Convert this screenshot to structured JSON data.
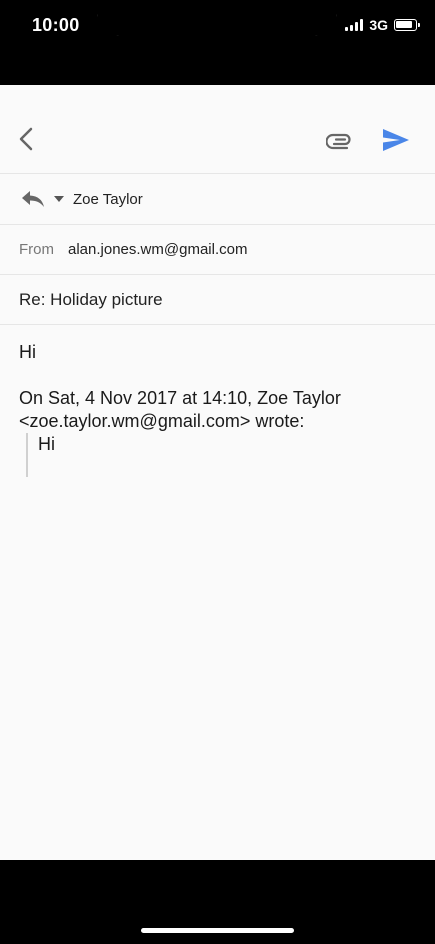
{
  "status": {
    "time": "10:00",
    "network": "3G",
    "battery_level": 0.9
  },
  "toolbar": {
    "back_icon": "chevron-left-icon",
    "attach_icon": "paperclip-icon",
    "send_icon": "send-icon",
    "accent_color": "#4a86e8"
  },
  "reply": {
    "icon": "reply-icon",
    "recipient": "Zoe Taylor"
  },
  "from": {
    "label": "From",
    "value": "alan.jones.wm@gmail.com"
  },
  "subject": "Re: Holiday picture",
  "body": {
    "greeting": "Hi",
    "quote_header_line1": "On Sat, 4 Nov 2017 at 14:10, Zoe Taylor",
    "quote_header_line2": "<zoe.taylor.wm@gmail.com> wrote:",
    "quoted_text": "Hi"
  }
}
